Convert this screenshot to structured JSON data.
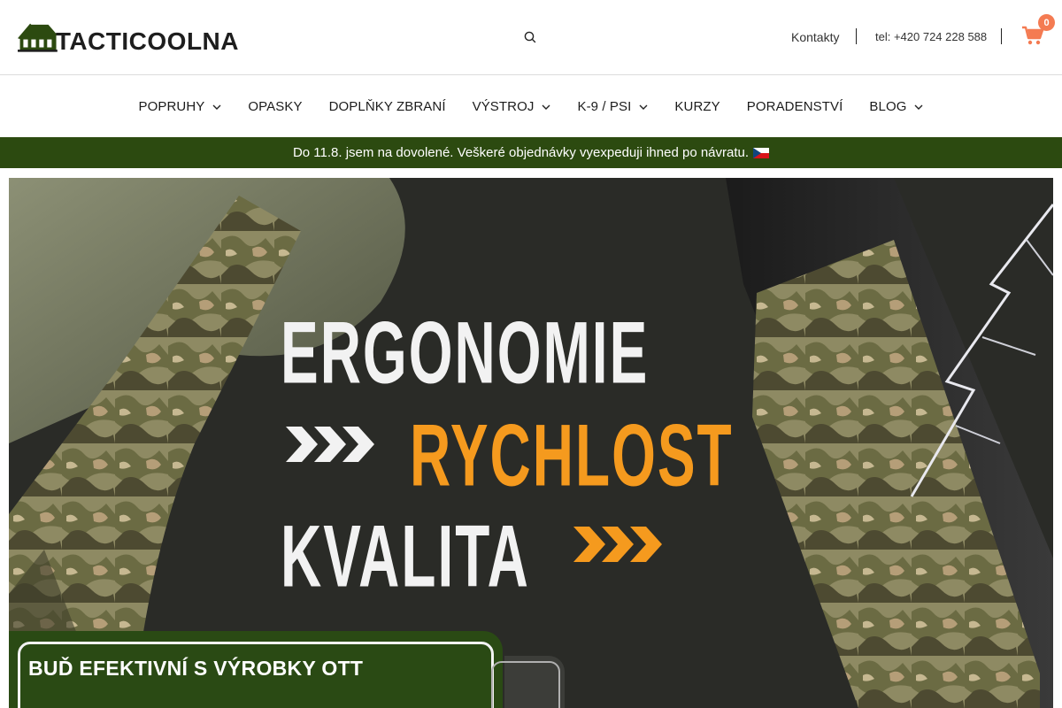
{
  "brand": {
    "name": "TACTICOOLNA",
    "logo_icon": "house-icon",
    "logo_color": "#2c4a10"
  },
  "header": {
    "search_icon": "search-icon",
    "contacts_label": "Kontakty",
    "phone_text": "tel: +420 724 228 588",
    "cart_icon": "cart-icon",
    "cart_count": "0",
    "cart_badge_color": "#f47b52"
  },
  "nav": {
    "items": [
      {
        "label": "POPRUHY",
        "has_dropdown": true
      },
      {
        "label": "OPASKY",
        "has_dropdown": false
      },
      {
        "label": "DOPLŇKY ZBRANÍ",
        "has_dropdown": false
      },
      {
        "label": "VÝSTROJ",
        "has_dropdown": true
      },
      {
        "label": "K-9 / PSI",
        "has_dropdown": true
      },
      {
        "label": "KURZY",
        "has_dropdown": false
      },
      {
        "label": "PORADENSTVÍ",
        "has_dropdown": false
      },
      {
        "label": "BLOG",
        "has_dropdown": true
      }
    ]
  },
  "notice": {
    "text": "Do 11.8. jsem na dovolené. Veškeré objednávky vyexpeduji ihned po návratu.",
    "flag_icon": "czech-flag-icon",
    "background": "#2c4a10"
  },
  "hero": {
    "line1": "ERGONOMIE",
    "line2": "RYCHLOST",
    "line3": "KVALITA",
    "accent_color": "#f59a1e",
    "cta_text": "BUĎ EFEKTIVNÍ S VÝROBKY OTT"
  }
}
